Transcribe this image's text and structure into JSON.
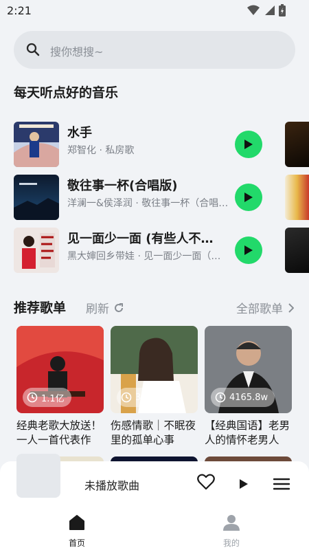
{
  "status": {
    "time": "2:21"
  },
  "search": {
    "placeholder": "搜你想搜~"
  },
  "daily": {
    "title": "每天听点好的音乐",
    "songs": [
      {
        "title": "水手",
        "subtitle": "郑智化 · 私房歌"
      },
      {
        "title": "敬往事一杯(合唱版)",
        "subtitle": "洋澜一&侯泽润 · 敬往事一杯（合唱版）"
      },
      {
        "title": "见一面少一面 (有些人不见就真的不见了)",
        "subtitle": "黑大婶回乡带娃 · 见一面少一面（有些人）"
      }
    ]
  },
  "recommend": {
    "title": "推荐歌单",
    "refresh_label": "刷新",
    "all_label": "全部歌单",
    "playlists": [
      {
        "count": "1.1亿",
        "name": "经典老歌大放送！一人一首代表作"
      },
      {
        "count": "3819w",
        "name": "伤感情歌｜不眠夜里的孤单心事"
      },
      {
        "count": "4165.8w",
        "name": "【经典国语】老男人的情怀老男人"
      }
    ]
  },
  "player": {
    "label": "未播放歌曲"
  },
  "tabs": [
    {
      "label": "首页",
      "active": true
    },
    {
      "label": "我的",
      "active": false
    }
  ],
  "colors": {
    "accent": "#22d96a",
    "background": "#f1f3f6"
  }
}
